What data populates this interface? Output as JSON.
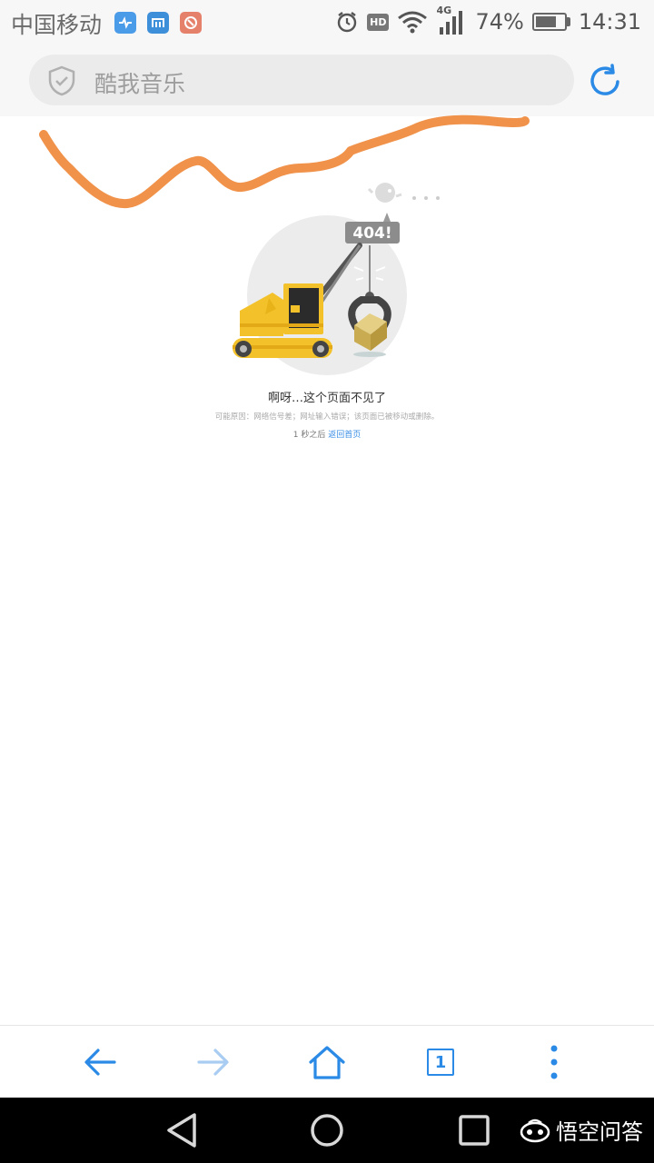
{
  "status_bar": {
    "carrier": "中国移动",
    "network_type": "4G",
    "hd_label": "HD",
    "battery_percent": "74%",
    "battery_level": 0.74,
    "time": "14:31",
    "app_icons": [
      "health-app-icon",
      "maxthon-app-icon",
      "tools-app-icon"
    ]
  },
  "address_bar": {
    "query": "酷我音乐"
  },
  "error_page": {
    "code": "404!",
    "title": "啊呀…这个页面不见了",
    "reasons": "可能原因：网络信号差；网址输入错误；该页面已被移动或删除。",
    "countdown": "1 秒之后",
    "back_link": "返回首页"
  },
  "toolbar": {
    "tab_count": "1"
  },
  "watermark": {
    "text": "悟空问答"
  },
  "colors": {
    "accent": "#2a8ae6",
    "scribble": "#f0924a",
    "crane_yellow": "#f3c22b"
  }
}
